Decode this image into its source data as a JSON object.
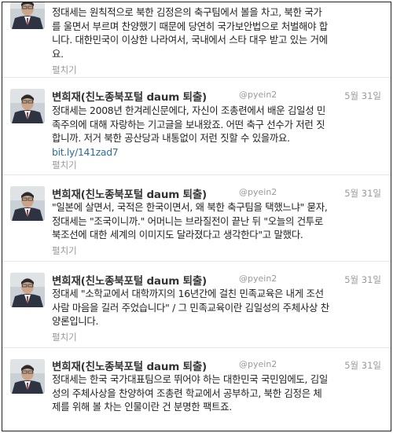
{
  "tweets": [
    {
      "name": "",
      "handle": "",
      "date": "",
      "lines": [
        "정대세는 원칙적으로 북한 김정은의 축구팀에서 볼을 차고, 북한 국가",
        "를 울면서 부르며 찬양했기 때문에 당연히 국가보안법으로 처벌해야 합",
        "니다. 대한민국이 이상한 나라여서, 국내에서 스타 대우 받고 있는 거에",
        "요."
      ],
      "link": "",
      "expand": "펼치기"
    },
    {
      "name": "변희재(친노종북포털 daum 퇴출)",
      "handle": "@pyein2",
      "date": "5월 31일",
      "lines": [
        "정대세는 2008년 한겨레신문에다, 자신이 조총련에서 배운 김일성 민",
        "족주의에 대해 자랑하는 기고글을 보내왔죠. 어떤 축구 선수가 저런 짓",
        "합니까. 저거 북한 공산당과 내통없이 저런 짓할 수 있을까요."
      ],
      "link": "bit.ly/141zad7",
      "expand": "펼치기"
    },
    {
      "name": "변희재(친노종북포털 daum 퇴출)",
      "handle": "@pyein2",
      "date": "5월 31일",
      "lines": [
        "\"일본에 살면서, 국적은 한국이면서, 왜 북한 축구팀을 택했느냐\" 묻자,",
        "정대세는 \"조국이니까.\" 어머니는 브라질전이 끝난 뒤 \"오늘의 건투로",
        "북조선에 대한 세계의 이미지도 달라졌다고 생각한다\"고 말했다."
      ],
      "link": "",
      "expand": "펼치기"
    },
    {
      "name": "변희재(친노종북포털 daum 퇴출)",
      "handle": "@pyein2",
      "date": "5월 31일",
      "lines": [
        "정대세 \"소학교에서 대학까지의 16년간에 걸친 민족교육은 내게 조선",
        "사람 마음을 길러 주었습니다\" / 그 민족교육이란 김일성의 주체사상 찬",
        "양론입니다."
      ],
      "link": "",
      "expand": "펼치기"
    },
    {
      "name": "변희재(친노종북포털 daum 퇴출)",
      "handle": "@pyein2",
      "date": "5월 31일",
      "lines": [
        "정대세는 한국 국가대표팀으로 뛰어야 하는 대한민국 국민임에도, 김일",
        "성의 주체사상을 찬양하여 조총련 학교에서 공부하고, 북한 김정은 체",
        "제를 위해 볼 차는 인물이란 건 분명한 팩트죠."
      ],
      "link": "",
      "expand": ""
    }
  ]
}
